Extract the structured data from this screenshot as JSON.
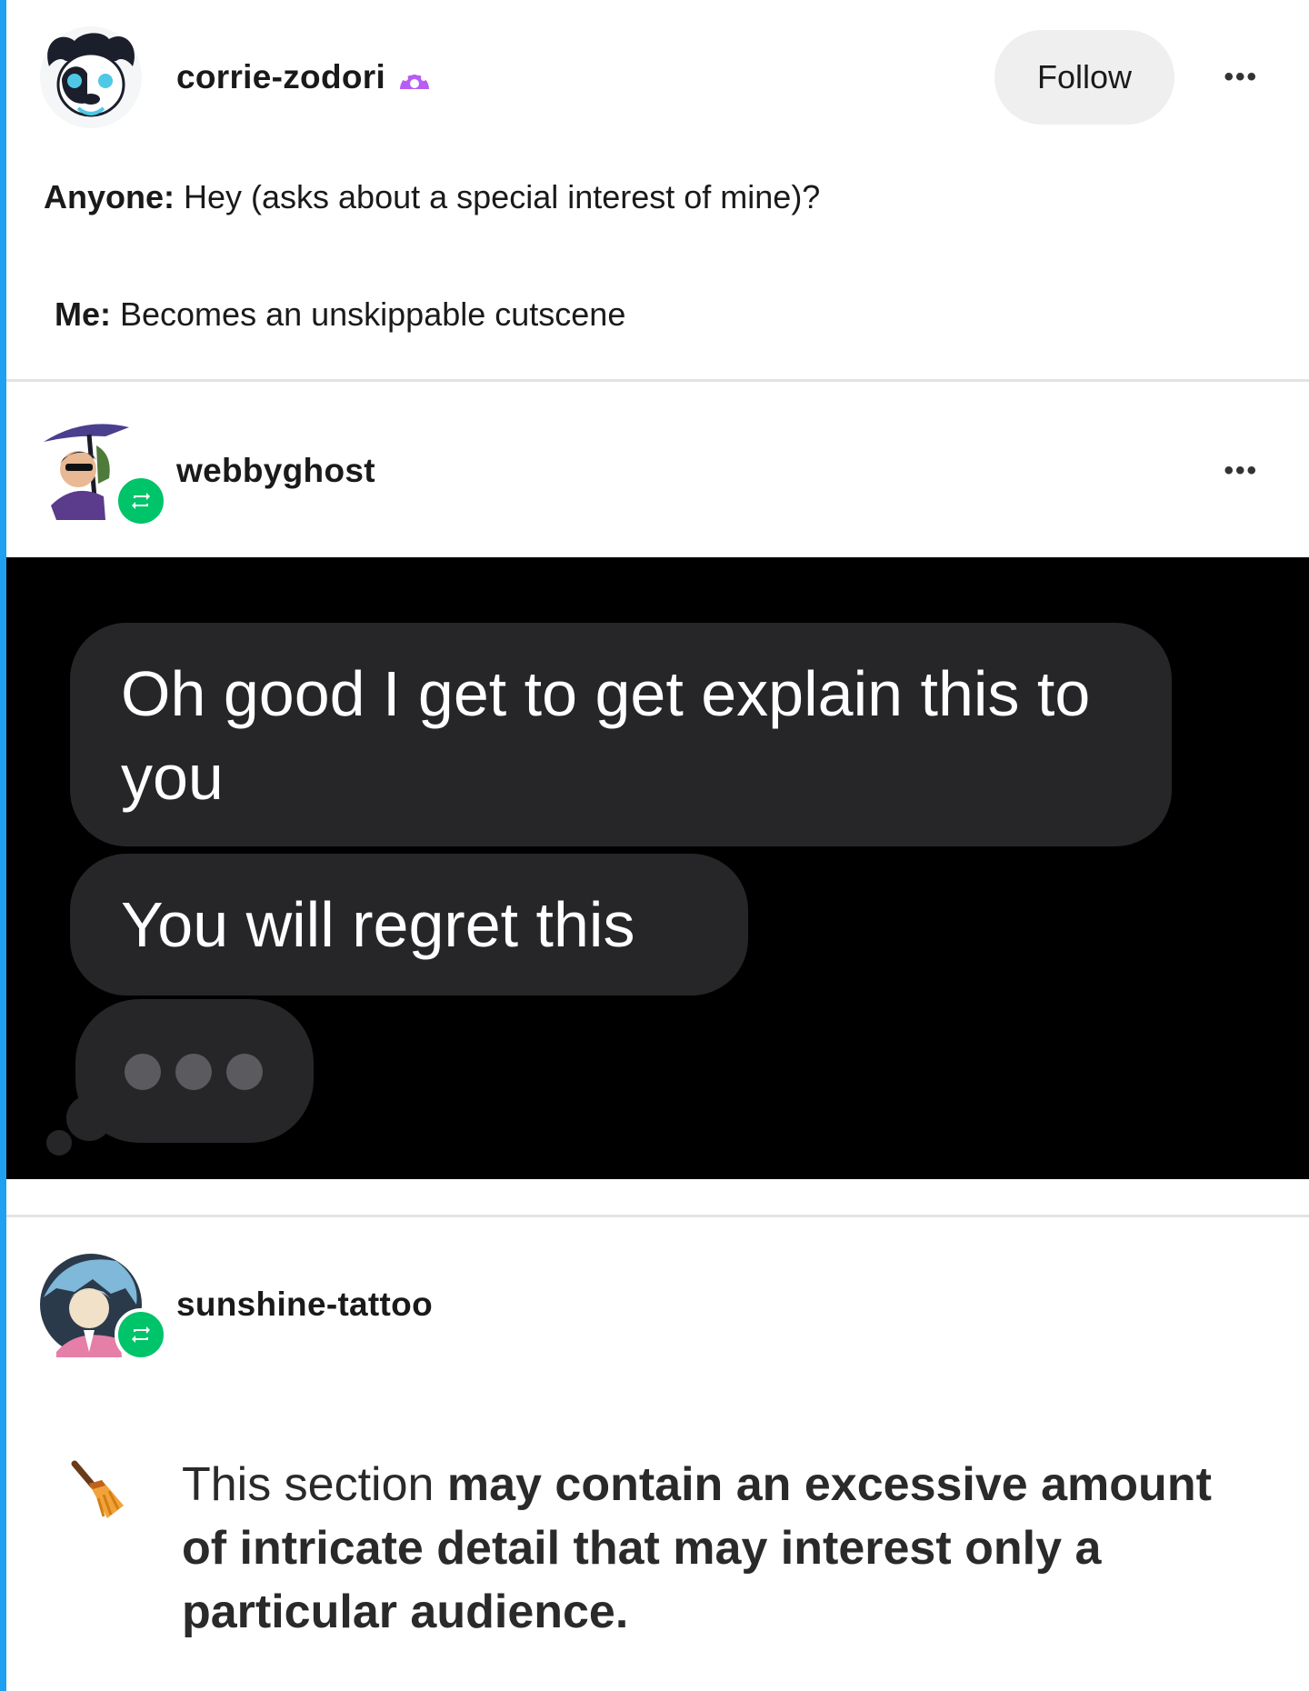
{
  "post1": {
    "username": "corrie-zodori",
    "follow_label": "Follow",
    "more_label": "•••",
    "line1_speaker": "Anyone:",
    "line1_text": " Hey (asks about a special interest of mine)?",
    "line2_speaker": "Me:",
    "line2_text": " Becomes an unskippable cutscene"
  },
  "post2": {
    "username": "webbyghost",
    "more_label": "•••",
    "messages": [
      "Oh good I get to get explain this to you",
      "You will regret this"
    ]
  },
  "post3": {
    "username": "sunshine-tattoo",
    "warning_normal": "This section ",
    "warning_bold": "may contain an excessive amount of intricate detail that may interest only a particular audience."
  },
  "colors": {
    "accent": "#1fa0f0",
    "reblog_green": "#00c46a",
    "bubble_gray": "#262628"
  }
}
